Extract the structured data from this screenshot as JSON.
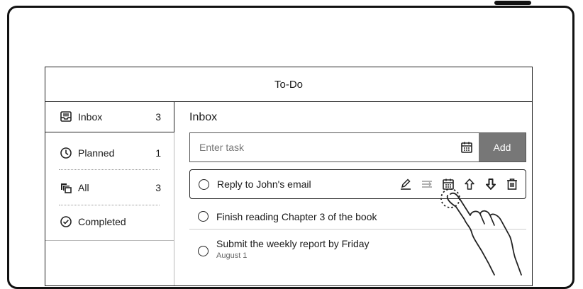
{
  "app": {
    "title": "To-Do"
  },
  "sidebar": {
    "items": [
      {
        "label": "Inbox",
        "count": "3",
        "icon": "inbox-icon"
      },
      {
        "label": "Planned",
        "count": "1",
        "icon": "clock-icon"
      },
      {
        "label": "All",
        "count": "3",
        "icon": "stack-icon"
      },
      {
        "label": "Completed",
        "count": "",
        "icon": "check-circle-icon"
      }
    ]
  },
  "main": {
    "heading": "Inbox",
    "input": {
      "placeholder": "Enter task",
      "value": ""
    },
    "add_label": "Add",
    "tasks": [
      {
        "title": "Reply to John's email",
        "subtitle": ""
      },
      {
        "title": "Finish reading Chapter 3 of the book",
        "subtitle": ""
      },
      {
        "title": "Submit the weekly report by Friday",
        "subtitle": "August 1"
      }
    ],
    "task_actions": [
      "edit-icon",
      "move-icon",
      "calendar-icon",
      "move-up-icon",
      "move-down-icon",
      "delete-icon"
    ]
  },
  "colors": {
    "accent": "#777777",
    "frame": "#111111",
    "text": "#1a1a1a"
  }
}
